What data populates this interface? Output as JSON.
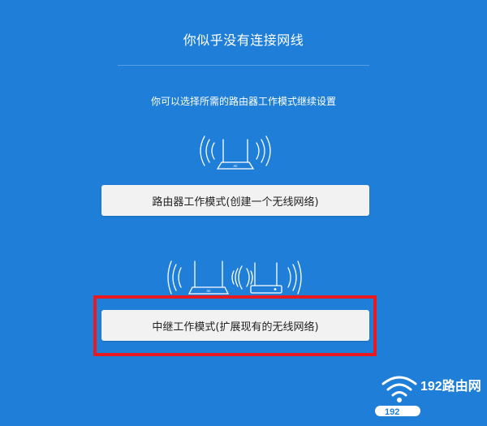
{
  "page": {
    "title": "你似乎没有连接网线",
    "subtitle": "你可以选择所需的路由器工作模式继续设置"
  },
  "modes": {
    "router_label": "路由器工作模式(创建一个无线网络)",
    "repeater_label": "中继工作模式(扩展现有的无线网络)"
  },
  "watermark": {
    "text": "192路由网",
    "badge": "192"
  },
  "colors": {
    "background": "#1f7fd8",
    "button_bg": "#f2f2f2",
    "highlight_border": "#e8191f"
  }
}
